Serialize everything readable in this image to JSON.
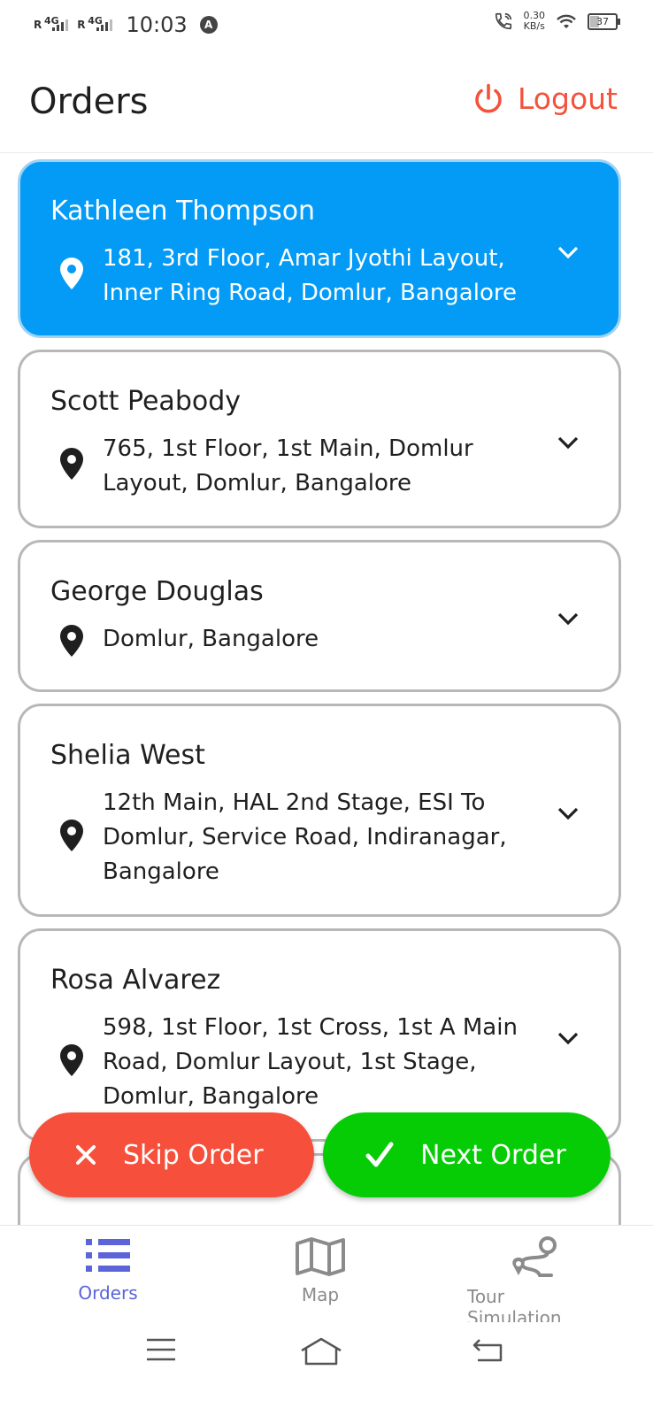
{
  "status_bar": {
    "time": "10:03",
    "sim1_roaming": "R",
    "sim1_network": "4G",
    "sim2_roaming": "R",
    "sim2_network": "4G",
    "net_speed_value": "0.30",
    "net_speed_unit": "KB/s",
    "battery": "37",
    "battery_level_percent": 37
  },
  "header": {
    "title": "Orders",
    "logout_label": "Logout",
    "logout_color": "#f4523b"
  },
  "orders": [
    {
      "name": "Kathleen Thompson",
      "address_lines": [
        "181, 3rd Floor, Amar Jyothi Layout,",
        "Inner Ring Road, Domlur, Bangalore"
      ],
      "active": true
    },
    {
      "name": "Scott Peabody",
      "address_lines": [
        "765, 1st Floor, 1st Main, Domlur",
        "Layout, Domlur, Bangalore"
      ],
      "active": false
    },
    {
      "name": "George Douglas",
      "address_lines": [
        "Domlur, Bangalore"
      ],
      "active": false
    },
    {
      "name": "Shelia West",
      "address_lines": [
        "12th Main, HAL 2nd Stage, ESI To",
        "Domlur, Service Road, Indiranagar,",
        "Bangalore"
      ],
      "active": false
    },
    {
      "name": "Rosa Alvarez",
      "address_lines": [
        "598, 1st Floor, 1st Cross, 1st A Main",
        "Road, Domlur Layout, 1st Stage,",
        "Domlur, Bangalore"
      ],
      "active": false
    }
  ],
  "actions": {
    "skip_label": "Skip Order",
    "next_label": "Next Order",
    "skip_color": "#f6503c",
    "next_color": "#06cc06"
  },
  "bottom_nav": {
    "items": [
      {
        "label": "Orders",
        "icon": "list-icon",
        "active": true
      },
      {
        "label": "Map",
        "icon": "map-icon",
        "active": false
      },
      {
        "label": "Tour Simulation",
        "icon": "route-icon",
        "active": false
      }
    ],
    "active_color": "#5b64d9"
  },
  "colors": {
    "active_card": "#039bf6",
    "card_border": "#b8b8b8"
  }
}
